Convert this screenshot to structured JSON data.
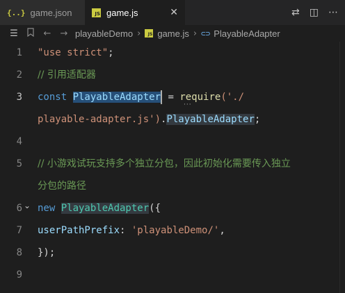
{
  "tabs": [
    {
      "label": "game.json",
      "icon": "{..}"
    },
    {
      "label": "game.js",
      "icon": "JS",
      "close": "✕"
    }
  ],
  "tab_actions": {
    "diff": "⇄",
    "split": "◫",
    "more": "⋯"
  },
  "breadcrumb": {
    "list_icon": "☰",
    "back": "←",
    "forward": "→",
    "bookmark": "🔖",
    "folder": "playableDemo",
    "file": "game.js",
    "file_icon": "JS",
    "symbol_icon": "⊂⊃",
    "symbol": "PlayableAdapter",
    "sep": "›"
  },
  "editor": {
    "lines": [
      {
        "num": "1",
        "tokens": [
          {
            "t": "\"use strict\"",
            "c": "str"
          },
          {
            "t": ";",
            "c": "plain"
          }
        ]
      },
      {
        "num": "2",
        "tokens": [
          {
            "t": "// 引用适配器",
            "c": "cmt"
          }
        ]
      },
      {
        "num": "3",
        "tokens": [
          {
            "t": "const ",
            "c": "kw"
          },
          {
            "t": "PlayableAdapter",
            "c": "var hl"
          },
          {
            "t": " = ",
            "c": "plain"
          },
          {
            "t": "require",
            "c": "fn"
          },
          {
            "t": "('./",
            "c": "str"
          }
        ]
      },
      {
        "num": "",
        "tokens": [
          {
            "t": "playable-adapter.js",
            "c": "str"
          },
          {
            "t": "')",
            "c": "str"
          },
          {
            "t": ".",
            "c": "plain"
          },
          {
            "t": "PlayableAdapter",
            "c": "var hl2"
          },
          {
            "t": ";",
            "c": "plain"
          }
        ]
      },
      {
        "num": "4",
        "tokens": []
      },
      {
        "num": "5",
        "tokens": [
          {
            "t": "// 小游戏试玩支持多个独立分包，因此初始化需要传入独立",
            "c": "cmt"
          }
        ]
      },
      {
        "num": "",
        "tokens": [
          {
            "t": "分包的路径",
            "c": "cmt"
          }
        ]
      },
      {
        "num": "6",
        "tokens": [
          {
            "t": "new ",
            "c": "kw"
          },
          {
            "t": "PlayableAdapter",
            "c": "cls hl2"
          },
          {
            "t": "({",
            "c": "plain"
          }
        ]
      },
      {
        "num": "7",
        "tokens": [
          {
            "t": "userPathPrefix",
            "c": "var"
          },
          {
            "t": ": ",
            "c": "plain"
          },
          {
            "t": "'playableDemo/'",
            "c": "str"
          },
          {
            "t": ",",
            "c": "plain"
          }
        ]
      },
      {
        "num": "8",
        "tokens": [
          {
            "t": "});",
            "c": "plain"
          }
        ]
      },
      {
        "num": "9",
        "tokens": []
      }
    ],
    "fold_icon": "⌄"
  }
}
